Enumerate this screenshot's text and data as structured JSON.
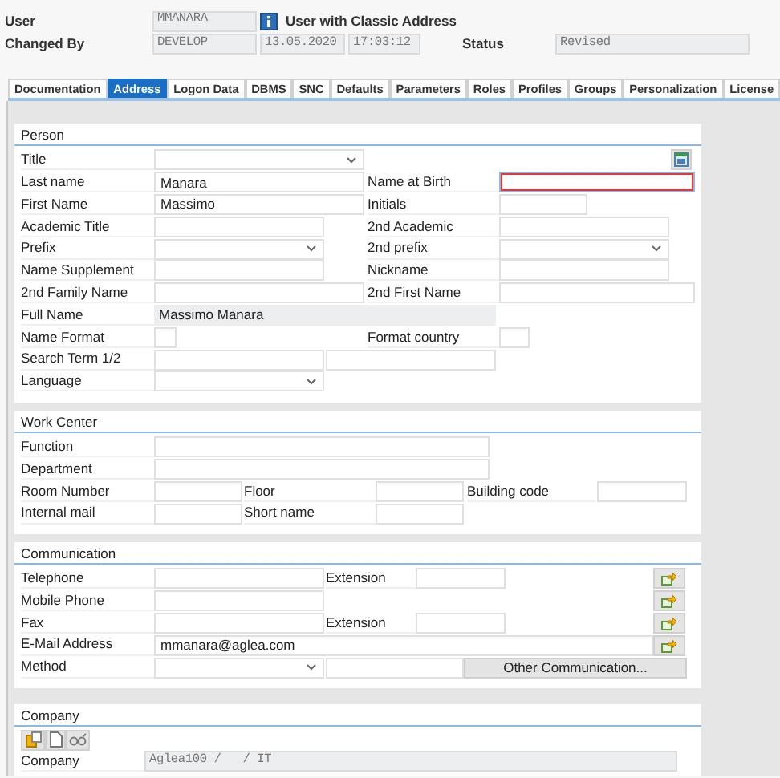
{
  "header": {
    "user_label": "User",
    "user": "MMANARA",
    "user_type": "User with Classic Address",
    "changed_by_label": "Changed By",
    "changed_by": "DEVELOP",
    "date": "13.05.2020",
    "time": "17:03:12",
    "status_label": "Status",
    "status": "Revised"
  },
  "tabs": [
    {
      "label": "Documentation",
      "selected": false
    },
    {
      "label": "Address",
      "selected": true
    },
    {
      "label": "Logon Data",
      "selected": false
    },
    {
      "label": "DBMS",
      "selected": false
    },
    {
      "label": "SNC",
      "selected": false
    },
    {
      "label": "Defaults",
      "selected": false
    },
    {
      "label": "Parameters",
      "selected": false
    },
    {
      "label": "Roles",
      "selected": false
    },
    {
      "label": "Profiles",
      "selected": false
    },
    {
      "label": "Groups",
      "selected": false
    },
    {
      "label": "Personalization",
      "selected": false
    },
    {
      "label": "License",
      "selected": false
    }
  ],
  "sections": [
    {
      "title": "Person",
      "rows": [
        [
          {
            "kind": "label",
            "text": "Title"
          },
          {
            "kind": "select"
          },
          {
            "kind": "calendar_button"
          }
        ],
        [
          {
            "kind": "label",
            "text": "Last name"
          },
          {
            "kind": "input",
            "value": "Manara",
            "focused": false
          },
          {
            "kind": "label",
            "text": "Name at Birth"
          },
          {
            "kind": "input",
            "focused": true
          }
        ],
        [
          {
            "kind": "label",
            "text": "First Name"
          },
          {
            "kind": "input",
            "value": "Massimo",
            "focused": false
          },
          {
            "kind": "label",
            "text": "Initials"
          },
          {
            "kind": "input",
            "focused": false
          }
        ],
        [
          {
            "kind": "label",
            "text": "Academic Title"
          },
          {
            "kind": "input",
            "focused": false
          },
          {
            "kind": "label",
            "text": "2nd Academic"
          },
          {
            "kind": "input",
            "focused": false
          }
        ],
        [
          {
            "kind": "label",
            "text": "Prefix"
          },
          {
            "kind": "select"
          },
          {
            "kind": "label",
            "text": "2nd prefix"
          },
          {
            "kind": "select"
          }
        ],
        [
          {
            "kind": "label",
            "text": "Name Supplement"
          },
          {
            "kind": "input",
            "focused": false
          },
          {
            "kind": "label",
            "text": "Nickname"
          },
          {
            "kind": "input",
            "focused": false
          }
        ],
        [
          {
            "kind": "label",
            "text": "2nd Family Name"
          },
          {
            "kind": "input",
            "focused": false
          },
          {
            "kind": "label",
            "text": "2nd First Name"
          },
          {
            "kind": "input",
            "focused": false
          }
        ],
        [
          {
            "kind": "label",
            "text": "Full Name"
          },
          {
            "kind": "display",
            "value": "Massimo Manara"
          }
        ],
        [
          {
            "kind": "label",
            "text": "Name Format"
          },
          {
            "kind": "input",
            "focused": false
          },
          {
            "kind": "label",
            "text": "Format country"
          },
          {
            "kind": "input",
            "focused": false
          }
        ],
        [
          {
            "kind": "label",
            "text": "Search Term 1/2"
          },
          {
            "kind": "input",
            "focused": false
          },
          {
            "kind": "input",
            "focused": false
          }
        ],
        [
          {
            "kind": "label",
            "text": "Language"
          },
          {
            "kind": "select"
          }
        ]
      ]
    },
    {
      "title": "Work Center",
      "rows": [
        [
          {
            "kind": "label",
            "text": "Function"
          },
          {
            "kind": "input",
            "focused": false
          }
        ],
        [
          {
            "kind": "label",
            "text": "Department"
          },
          {
            "kind": "input",
            "focused": false
          }
        ],
        [
          {
            "kind": "label",
            "text": "Room Number"
          },
          {
            "kind": "input",
            "focused": false
          },
          {
            "kind": "label",
            "text": "Floor"
          },
          {
            "kind": "input",
            "focused": false
          },
          {
            "kind": "label",
            "text": "Building code"
          },
          {
            "kind": "input",
            "focused": false
          }
        ],
        [
          {
            "kind": "label",
            "text": "Internal mail"
          },
          {
            "kind": "input",
            "focused": false
          },
          {
            "kind": "label",
            "text": "Short name"
          },
          {
            "kind": "input",
            "focused": false
          }
        ]
      ]
    },
    {
      "title": "Communication",
      "rows": [
        [
          {
            "kind": "label",
            "text": "Telephone"
          },
          {
            "kind": "input",
            "focused": false
          },
          {
            "kind": "label",
            "text": "Extension"
          },
          {
            "kind": "input",
            "focused": false
          },
          {
            "kind": "transfer_button"
          }
        ],
        [
          {
            "kind": "label",
            "text": "Mobile Phone"
          },
          {
            "kind": "input",
            "focused": false
          },
          {
            "kind": "transfer_button"
          }
        ],
        [
          {
            "kind": "label",
            "text": "Fax"
          },
          {
            "kind": "input",
            "focused": false
          },
          {
            "kind": "label",
            "text": "Extension"
          },
          {
            "kind": "input",
            "focused": false
          },
          {
            "kind": "transfer_button"
          }
        ],
        [
          {
            "kind": "label",
            "text": "E-Mail Address"
          },
          {
            "kind": "input",
            "value": "mmanara@aglea.com",
            "focused": false
          },
          {
            "kind": "transfer_button"
          }
        ],
        [
          {
            "kind": "label",
            "text": "Method"
          },
          {
            "kind": "select"
          },
          {
            "kind": "input",
            "focused": false
          },
          {
            "kind": "button",
            "text": "Other Communication..."
          }
        ]
      ]
    },
    {
      "title": "Company",
      "rows": [
        [
          {
            "kind": "paste_button"
          },
          {
            "kind": "page_button"
          },
          {
            "kind": "glasses_button"
          }
        ],
        [
          {
            "kind": "label",
            "text": "Company"
          },
          {
            "kind": "readonly",
            "value": "Aglea100 /   / IT"
          }
        ]
      ]
    }
  ]
}
